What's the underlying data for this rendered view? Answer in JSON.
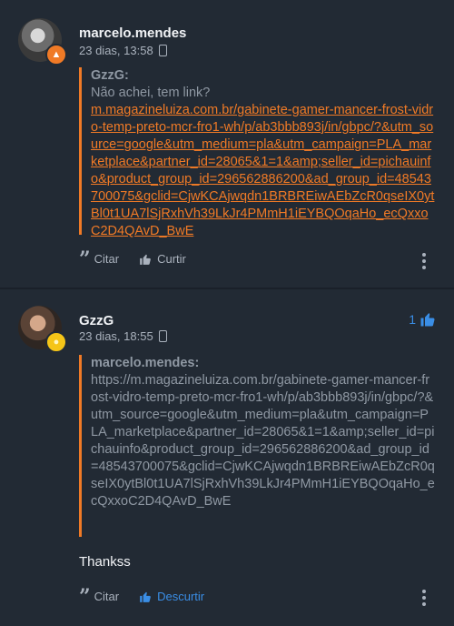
{
  "posts": [
    {
      "author": "marcelo.mendes",
      "time": "23 dias, 13:58",
      "badge_icon": "flame-icon",
      "quote": {
        "author": "GzzG:",
        "text": "Não achei, tem link?",
        "link": "m.magazineluiza.com.br/gabinete-gamer-mancer-frost-vidro-temp-preto-mcr-fro1-wh/p/ab3bbb893j/in/gbpc/?&utm_source=google&utm_medium=pla&utm_campaign=PLA_marketplace&partner_id=28065&1=1&amp;seller_id=pichauinfo&product_group_id=296562886200&ad_group_id=48543700075&gclid=CjwKCAjwqdn1BRBREiwAEbZcR0qseIX0ytBl0t1UA7lSjRxhVh39LkJr4PMmH1iEYBQOqaHo_ecQxxoC2D4QAvD_BwE"
      },
      "actions": {
        "quote_label": "Citar",
        "like_label": "Curtir"
      }
    },
    {
      "author": "GzzG",
      "time": "23 dias, 18:55",
      "badge_icon": "sun-icon",
      "like_count": "1",
      "quote": {
        "author": "marcelo.mendes:",
        "link": "https://m.magazineluiza.com.br/gabinete-gamer-mancer-frost-vidro-temp-preto-mcr-fro1-wh/p/ab3bbb893j/in/gbpc/?&utm_source=google&utm_medium=pla&utm_campaign=PLA_marketplace&partner_id=28065&1=1&amp;seller_id=pichauinfo&product_group_id=296562886200&ad_group_id=48543700075&gclid=CjwKCAjwqdn1BRBREiwAEbZcR0qseIX0ytBl0t1UA7lSjRxhVh39LkJr4PMmH1iEYBQOqaHo_ecQxxoC2D4QAvD_BwE"
      },
      "reply": "Thankss",
      "actions": {
        "quote_label": "Citar",
        "like_label": "Descurtir"
      }
    }
  ],
  "colors": {
    "background": "#222a34",
    "accent": "#f07a26",
    "like": "#3a8ee6"
  }
}
